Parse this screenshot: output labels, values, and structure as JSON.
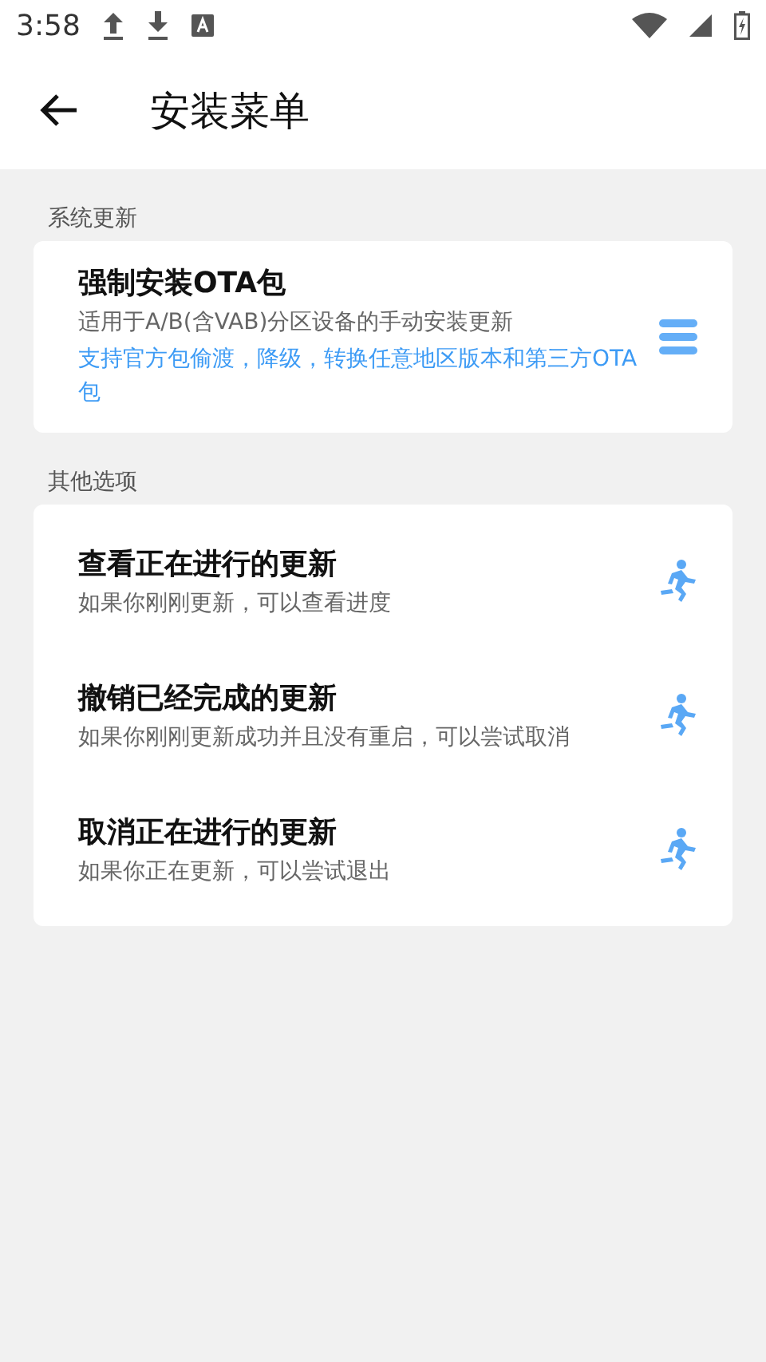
{
  "status_bar": {
    "time": "3:58"
  },
  "app_bar": {
    "title": "安装菜单"
  },
  "sections": [
    {
      "header": "系统更新",
      "items": [
        {
          "kind": "menu",
          "title": "强制安装OTA包",
          "subtitle": "适用于A/B(含VAB)分区设备的手动安装更新",
          "note": "支持官方包偷渡，降级，转换任意地区版本和第三方OTA包"
        }
      ]
    },
    {
      "header": "其他选项",
      "items": [
        {
          "kind": "run",
          "title": "查看正在进行的更新",
          "subtitle": "如果你刚刚更新，可以查看进度"
        },
        {
          "kind": "run",
          "title": "撤销已经完成的更新",
          "subtitle": "如果你刚刚更新成功并且没有重启，可以尝试取消"
        },
        {
          "kind": "run",
          "title": "取消正在进行的更新",
          "subtitle": "如果你正在更新，可以尝试退出"
        }
      ]
    }
  ]
}
